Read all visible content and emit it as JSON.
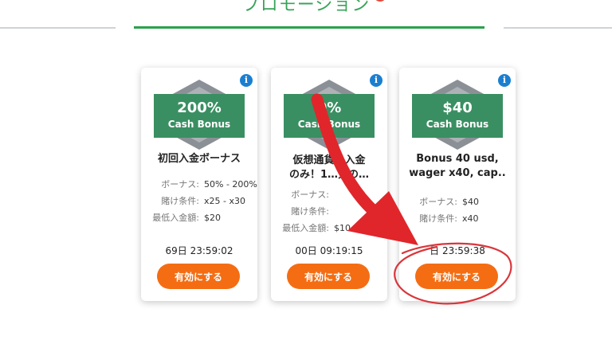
{
  "header": {
    "title": "プロモーション"
  },
  "cards": [
    {
      "badge_value": "200%",
      "badge_label": "Cash Bonus",
      "title_lines": [
        "初回入金ボーナス"
      ],
      "details": [
        {
          "label": "ボーナス:",
          "value": "50% - 200%"
        },
        {
          "label": "賭け条件:",
          "value": "x25 - x30"
        },
        {
          "label": "最低入金額:",
          "value": "$20"
        }
      ],
      "timer": "69日  23:59:02",
      "button_label": "有効にする"
    },
    {
      "badge_value": "0%",
      "badge_label": "Cash Bonus",
      "title_lines": [
        "仮想通貨の入金",
        "のみ！1…分の…"
      ],
      "details": [
        {
          "label": "ボーナス:",
          "value": ""
        },
        {
          "label": "賭け条件:",
          "value": ""
        },
        {
          "label": "最低入金額:",
          "value": "$10"
        }
      ],
      "timer": "00日  09:19:15",
      "button_label": "有効にする"
    },
    {
      "badge_value": "$40",
      "badge_label": "Cash Bonus",
      "title_lines": [
        "Bonus 40 usd,",
        "wager x40, cap.."
      ],
      "details": [
        {
          "label": "ボーナス:",
          "value": "$40"
        },
        {
          "label": "賭け条件:",
          "value": "x40"
        }
      ],
      "timer": "日  23:59:38",
      "button_label": "有効にする"
    }
  ],
  "colors": {
    "accent_green": "#2aa14a",
    "badge_green": "#3a8f62",
    "button_orange": "#f46d13",
    "info_blue": "#1b7fd1",
    "annotation_red": "#e0262b"
  }
}
